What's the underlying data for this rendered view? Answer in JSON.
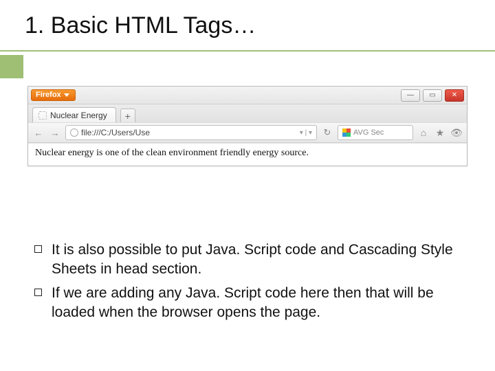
{
  "slide": {
    "title": "1. Basic HTML Tags…"
  },
  "browser": {
    "app_badge": "Firefox",
    "window_buttons": {
      "min_glyph": "—",
      "max_glyph": "▭",
      "close_glyph": "✕"
    },
    "tab": {
      "title": "Nuclear Energy"
    },
    "newtab_glyph": "+",
    "nav": {
      "back_glyph": "←",
      "fwd_glyph": "→"
    },
    "address": {
      "text": "file:///C:/Users/Use"
    },
    "reload_glyph": "↻",
    "search": {
      "placeholder": "AVG Sec"
    },
    "home_glyph": "⌂",
    "bookmark_glyph": "★",
    "view_glyph": "👁",
    "page_content": "Nuclear energy is one of the clean environment friendly energy source."
  },
  "bullets": [
    "It is also possible to put Java. Script code and Cascading Style Sheets in head section.",
    "If we are adding any Java. Script code here then that will be loaded when the browser opens the page."
  ]
}
